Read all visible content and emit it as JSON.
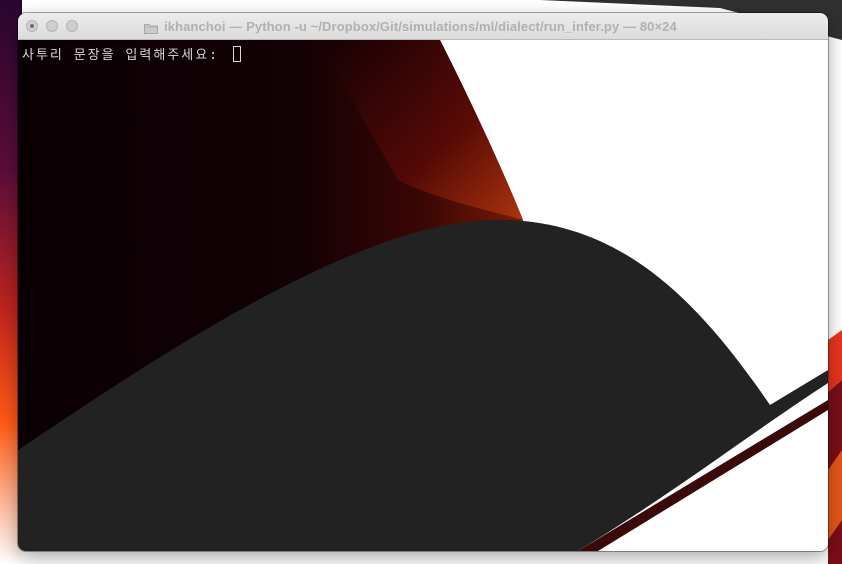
{
  "window": {
    "title": "ikhanchoi — Python -u ~/Dropbox/Git/simulations/ml/dialect/run_infer.py — 80×24"
  },
  "titlebar": {
    "close_icon": "traffic-light-close",
    "minimize_icon": "traffic-light-minimize",
    "zoom_icon": "traffic-light-zoom",
    "proxy_icon": "folder-icon"
  },
  "terminal": {
    "prompt": "사투리 문장을 입력해주세요: ",
    "cursor": "block-cursor"
  },
  "colors": {
    "terminal_background": "#222222",
    "terminal_text": "#d8d8d8",
    "title_text": "#b0b0b0",
    "wallpaper_red": "#e8341c",
    "wallpaper_purple": "#3a0a3e"
  }
}
